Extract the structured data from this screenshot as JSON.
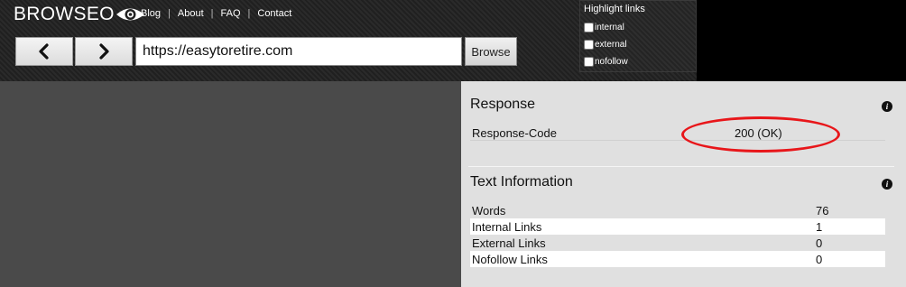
{
  "header": {
    "logo_text": "BROWSEO",
    "nav": [
      "Blog",
      "About",
      "FAQ",
      "Contact"
    ],
    "nav_separator": "|"
  },
  "toolbar": {
    "back_icon": "chevron-left-icon",
    "forward_icon": "chevron-right-icon",
    "url_value": "https://easytoretire.com",
    "browse_label": "Browse"
  },
  "highlight": {
    "title": "Highlight links",
    "options": [
      {
        "label": "internal",
        "checked": false
      },
      {
        "label": "external",
        "checked": false
      },
      {
        "label": "nofollow",
        "checked": false
      }
    ]
  },
  "response": {
    "title": "Response",
    "rows": [
      {
        "label": "Response-Code",
        "value": "200 (OK)"
      }
    ],
    "annotation_color": "#e8161a"
  },
  "text_info": {
    "title": "Text Information",
    "rows": [
      {
        "label": "Words",
        "value": "76"
      },
      {
        "label": "Internal Links",
        "value": "1"
      },
      {
        "label": "External Links",
        "value": "0"
      },
      {
        "label": "Nofollow Links",
        "value": "0"
      }
    ]
  },
  "info_icon_glyph": "i"
}
